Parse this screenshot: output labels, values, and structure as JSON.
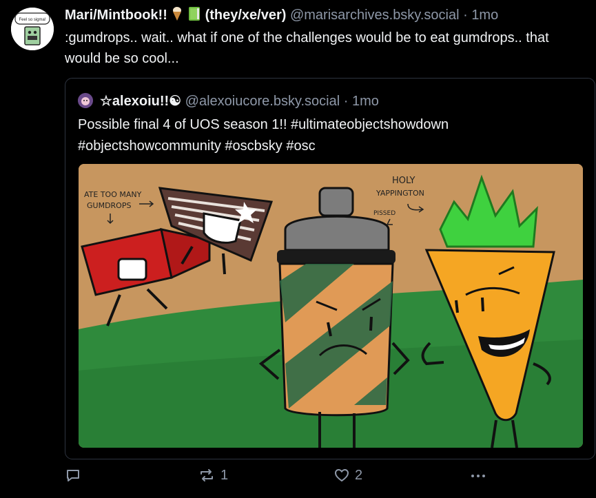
{
  "post": {
    "display_name": "Mari/Mintbook!!",
    "pronouns": "(they/xe/ver)",
    "handle": "@marisarchives.bsky.social",
    "separator": "·",
    "time": "1mo",
    "text": ":gumdrops.. wait.. what if one of the challenges would be to eat gumdrops.. that would be so cool...",
    "avatar_caption": "Feel so sigma!"
  },
  "quote": {
    "display_name": "☆alexoiu!!☯",
    "handle": "@alexoiucore.bsky.social",
    "separator": "·",
    "time": "1mo",
    "text": "Possible final 4 of UOS season 1!! #ultimateobjectshowdown #objectshowcommunity #oscbsky #osc",
    "image": {
      "annotation_left_1": "ATE TOO MANY",
      "annotation_left_2": "GUMDROPS",
      "annotation_right_1": "HOLY",
      "annotation_right_2": "YAPPINGTON",
      "annotation_right_3": "PISSED"
    }
  },
  "actions": {
    "reply_count": "",
    "repost_count": "1",
    "like_count": "2"
  },
  "icons": [
    "reply-icon",
    "repost-icon",
    "heart-icon",
    "more-icon",
    "ice-cream-emoji",
    "book-emoji"
  ],
  "colors": {
    "background": "#000000",
    "text": "#f1f3f5",
    "muted": "#8e98a8",
    "border": "#2e3440"
  }
}
